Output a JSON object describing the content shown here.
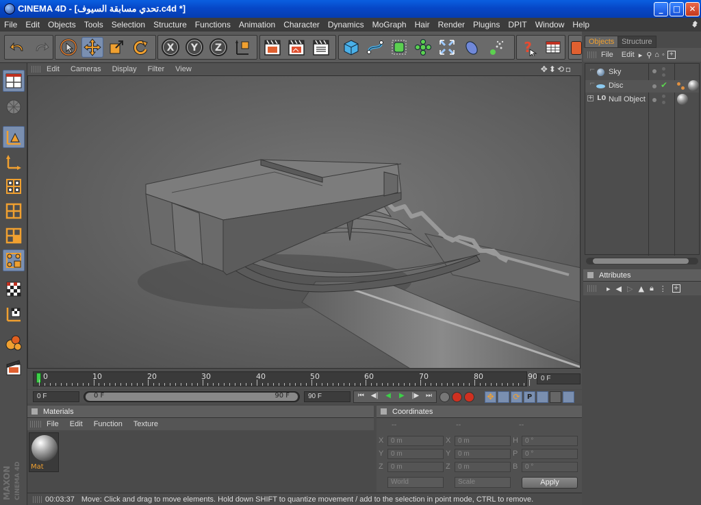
{
  "window": {
    "title": "CINEMA 4D - [تحدي مسابقة السيوف.c4d *]",
    "minimize": "_",
    "maximize": "□",
    "close": "✕"
  },
  "menubar": [
    "File",
    "Edit",
    "Objects",
    "Tools",
    "Selection",
    "Structure",
    "Functions",
    "Animation",
    "Character",
    "Dynamics",
    "MoGraph",
    "Hair",
    "Render",
    "Plugins",
    "DPIT",
    "Window",
    "Help"
  ],
  "viewport": {
    "menu": [
      "Edit",
      "Cameras",
      "Display",
      "Filter",
      "View"
    ]
  },
  "timeline": {
    "ticks": [
      "0",
      "10",
      "20",
      "30",
      "40",
      "50",
      "60",
      "70",
      "80",
      "90"
    ],
    "current_frame": "0 F"
  },
  "transport": {
    "start": "0 F",
    "range_start": "0 F",
    "range_end": "90 F",
    "end": "90 F"
  },
  "materials": {
    "title": "Materials",
    "menu": [
      "File",
      "Edit",
      "Function",
      "Texture"
    ],
    "items": [
      {
        "name": "Mat"
      }
    ]
  },
  "coordinates": {
    "title": "Coordinates",
    "col_headers": [
      "--",
      "--",
      "--"
    ],
    "rows": [
      {
        "l1": "X",
        "v1": "0 m",
        "l2": "X",
        "v2": "0 m",
        "l3": "H",
        "v3": "0 °"
      },
      {
        "l1": "Y",
        "v1": "0 m",
        "l2": "Y",
        "v2": "0 m",
        "l3": "P",
        "v3": "0 °"
      },
      {
        "l1": "Z",
        "v1": "0 m",
        "l2": "Z",
        "v2": "0 m",
        "l3": "B",
        "v3": "0 °"
      }
    ],
    "mode_world": "World",
    "mode_scale": "Scale",
    "apply": "Apply"
  },
  "objects_panel": {
    "tabs": [
      "Objects",
      "Structure"
    ],
    "menu": [
      "File",
      "Edit"
    ],
    "items": [
      "Sky",
      "Disc",
      "Null Object"
    ]
  },
  "attributes": {
    "title": "Attributes"
  },
  "status": {
    "time": "00:03:37",
    "message": "Move: Click and drag to move elements. Hold down SHIFT to quantize movement / add to the selection in point mode, CTRL to remove."
  },
  "brand": {
    "line1": "MAXON",
    "line2": "CINEMA 4D"
  },
  "colors": {
    "title_bar": "#0550d0",
    "accent_orange": "#f0a030",
    "active_tool": "#7a8fb0",
    "viewport_bg": "#676767",
    "timeline_marker": "#3cd048"
  }
}
